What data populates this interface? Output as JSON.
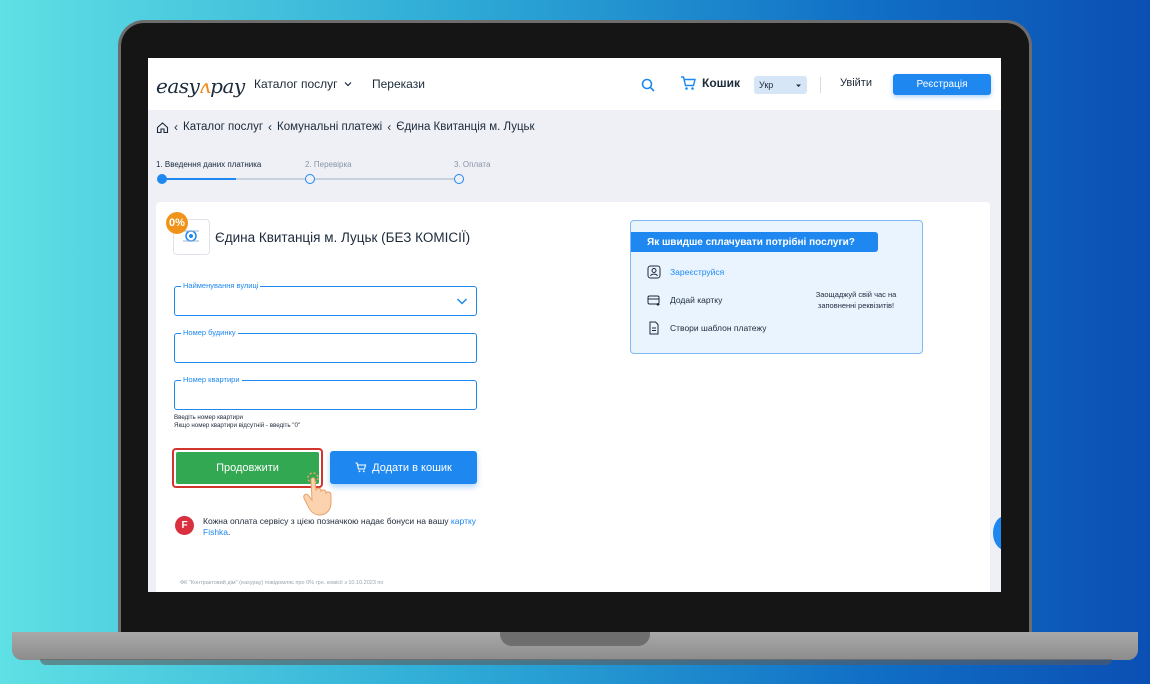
{
  "header": {
    "logo_text": "easy",
    "logo_text2": "pay",
    "catalog_label": "Каталог послуг",
    "transfers_label": "Перекази",
    "cart_label": "Кошик",
    "lang_value": "Укр",
    "login_label": "Увійти",
    "register_label": "Реєстрація"
  },
  "breadcrumb": {
    "items": [
      "Каталог послуг",
      "Комунальні платежі",
      "Єдина Квитанція м. Луцьк"
    ]
  },
  "steps": [
    {
      "label": "1. Введення даних платника",
      "state": "active"
    },
    {
      "label": "2. Перевірка",
      "state": "inactive"
    },
    {
      "label": "3. Оплата",
      "state": "inactive"
    }
  ],
  "service": {
    "badge": "0%",
    "title": "Єдина Квитанція м. Луцьк (БЕЗ КОМІСІЇ)"
  },
  "form": {
    "street_label": "Найменування вулиці",
    "street_value": "",
    "house_label": "Номер будинку",
    "house_value": "",
    "apartment_label": "Номер квартири",
    "apartment_value": "",
    "hint_line1": "Введіть номер квартири",
    "hint_line2": "Якщо номер квартири відсутній - введіть \"0\""
  },
  "buttons": {
    "continue_label": "Продовжити",
    "add_to_cart_label": "Додати в кошик"
  },
  "fishka": {
    "icon_letter": "F",
    "text": "Кожна оплата сервісу з цією позначкою надає бонуси на вашу",
    "link": "картку Fishka",
    "tail": "."
  },
  "disclaimer": "ФК \"Контрактовий дім\" (easypay) повідомляє про 0% грн. комісії з 10.10.2023 по",
  "promo": {
    "title": "Як швидше сплачувати потрібні послуги?",
    "register_link": "Зареєструйся",
    "add_card": "Додай картку",
    "create_template": "Створи шаблон платежу",
    "note": "Заощаджуй свій час на заповненні реквізитів!"
  },
  "colors": {
    "accent": "#1e88f0",
    "continue_green": "#33a852",
    "highlight_red": "#d2342e",
    "badge_orange": "#f0931a",
    "fishka_red": "#d92f3e"
  }
}
